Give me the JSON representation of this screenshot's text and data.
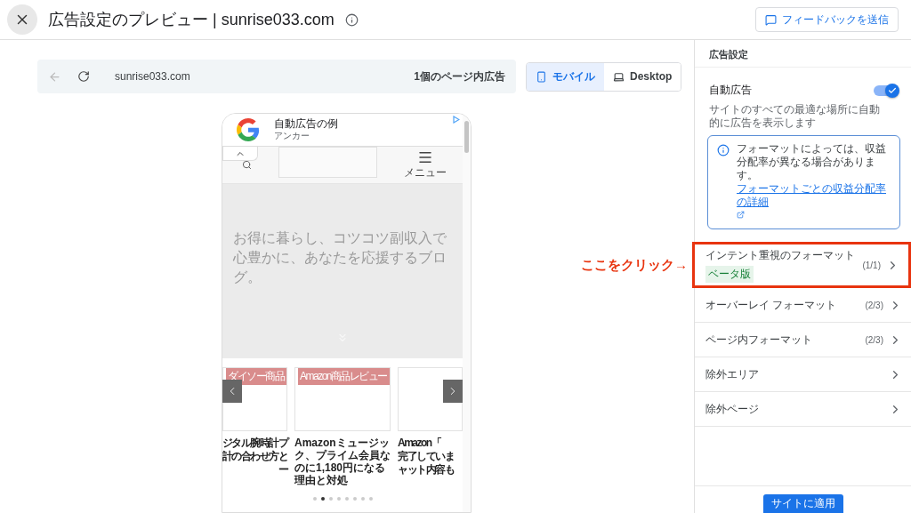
{
  "header": {
    "title": "広告設定のプレビュー | sunrise033.com",
    "feedback_button": "フィードバックを送信"
  },
  "toolbar": {
    "url": "sunrise033.com",
    "ad_count": "1個のページ内広告"
  },
  "device_tabs": [
    {
      "label": "モバイル",
      "kind": "mobile",
      "selected": true
    },
    {
      "label": "Desktop",
      "kind": "desktop",
      "selected": false
    }
  ],
  "phone": {
    "ad": {
      "title": "自動広告の例",
      "subtitle": "アンカー"
    },
    "menu_label": "メニュー",
    "tagline": "お得に暮らし、コツコツ副収入で心豊かに、あなたを応援するブログ。",
    "cards": [
      {
        "tag": "ダイソー商品",
        "lines": [
          "ジタル腕時計プ",
          "計の合わせ方と",
          "ー"
        ]
      },
      {
        "tag": "Amazon商品レビュー",
        "title": "Amazonミュージック、プライム会員なのに1,180円になる理由と対処"
      },
      {
        "lines": [
          "Amazon「",
          "完了していま",
          "ャット内容も"
        ]
      }
    ],
    "dots": [
      {
        "selected": false
      },
      {
        "selected": true
      },
      {
        "selected": false
      },
      {
        "selected": false
      },
      {
        "selected": false
      },
      {
        "selected": false
      },
      {
        "selected": false
      },
      {
        "selected": false
      }
    ]
  },
  "annotation": "ここをクリック→",
  "panel": {
    "title": "広告設定",
    "auto_ads": {
      "label": "自動広告",
      "on": true,
      "description": "サイトのすべての最適な場所に自動的に広告を表示します"
    },
    "notice": {
      "text": "フォーマットによっては、収益分配率が異なる場合があります。",
      "link": "フォーマットごとの収益分配率の詳細"
    },
    "items": [
      {
        "label": "インテント重視のフォーマット",
        "badge": "ベータ版",
        "count": "(1/1)",
        "highlighted": true
      },
      {
        "label": "オーバーレイ フォーマット",
        "count": "(2/3)",
        "highlighted": false
      },
      {
        "label": "ページ内フォーマット",
        "count": "(2/3)",
        "highlighted": false
      },
      {
        "label": "除外エリア",
        "highlighted": false
      },
      {
        "label": "除外ページ",
        "highlighted": false
      }
    ],
    "apply_button": "サイトに適用"
  }
}
